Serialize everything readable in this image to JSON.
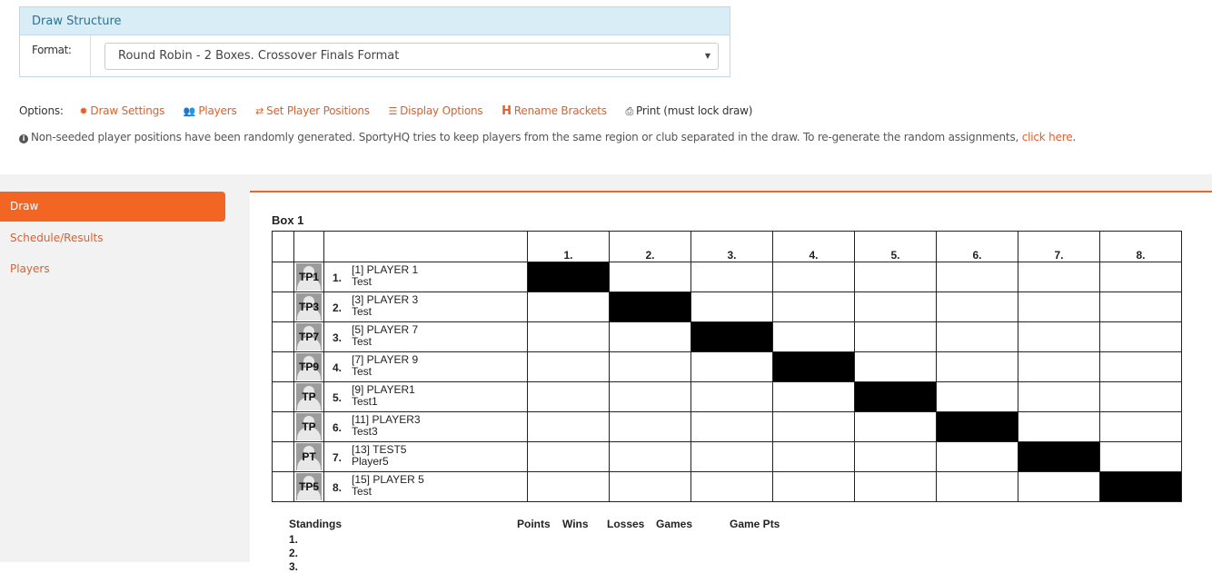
{
  "draw_structure": {
    "title": "Draw Structure",
    "format_label": "Format:",
    "format_value": "Round Robin - 2 Boxes. Crossover Finals Format"
  },
  "options": {
    "label": "Options:",
    "items": [
      {
        "label": "Draw Settings",
        "icon": "gear-icon"
      },
      {
        "label": "Players",
        "icon": "users-icon"
      },
      {
        "label": "Set Player Positions",
        "icon": "exchange-icon"
      },
      {
        "label": "Display Options",
        "icon": "list-icon"
      },
      {
        "label": "Rename Brackets",
        "icon": "h-icon"
      },
      {
        "label": "Print (must lock draw)",
        "icon": "print-icon"
      }
    ]
  },
  "notice": {
    "text": "Non-seeded player positions have been randomly generated. SportyHQ tries to keep players from the same region or club separated in the draw. To re-generate the random assignments, ",
    "link": "click here",
    "end": "."
  },
  "sidebar": {
    "items": [
      {
        "label": "Draw",
        "active": true
      },
      {
        "label": "Schedule/Results",
        "active": false
      },
      {
        "label": "Players",
        "active": false
      }
    ]
  },
  "box": {
    "title": "Box 1",
    "columns": [
      "1.",
      "2.",
      "3.",
      "4.",
      "5.",
      "6.",
      "7.",
      "8."
    ],
    "players": [
      {
        "avatar": "TP1",
        "num": "1.",
        "name": "[1] PLAYER 1",
        "club": "Test"
      },
      {
        "avatar": "TP3",
        "num": "2.",
        "name": "[3] PLAYER 3",
        "club": "Test"
      },
      {
        "avatar": "TP7",
        "num": "3.",
        "name": "[5] PLAYER 7",
        "club": "Test"
      },
      {
        "avatar": "TP9",
        "num": "4.",
        "name": "[7] PLAYER 9",
        "club": "Test"
      },
      {
        "avatar": "TP",
        "num": "5.",
        "name": "[9] PLAYER1",
        "club": "Test1"
      },
      {
        "avatar": "TP",
        "num": "6.",
        "name": "[11] PLAYER3",
        "club": "Test3"
      },
      {
        "avatar": "PT",
        "num": "7.",
        "name": "[13] TEST5",
        "club": "Player5"
      },
      {
        "avatar": "TP5",
        "num": "8.",
        "name": "[15] PLAYER 5",
        "club": "Test"
      }
    ]
  },
  "standings": {
    "title": "Standings",
    "headers": [
      "Points",
      "Wins",
      "Losses",
      "Games",
      "Game Pts"
    ],
    "rows": [
      "1.",
      "2.",
      "3."
    ]
  }
}
